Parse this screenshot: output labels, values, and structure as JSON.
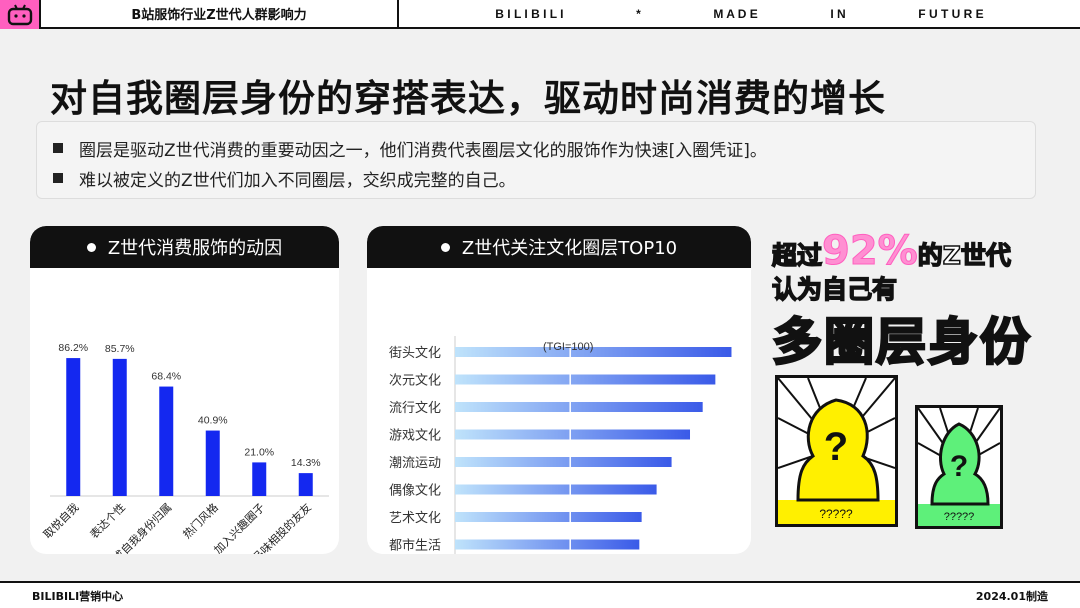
{
  "header": {
    "title": "B站服饰行业Z世代人群影响力",
    "slogan": [
      "B I L I B I L I",
      "*",
      "M A D E",
      "I N",
      "F U T U R E"
    ]
  },
  "headline": "对自我圈层身份的穿搭表达，驱动时尚消费的增长",
  "bullets": [
    "圈层是驱动Z世代消费的重要动因之一，他们消费代表圈层文化的服饰作为快速[入圈凭证]。",
    "难以被定义的Z世代们加入不同圈层，交织成完整的自己。"
  ],
  "chart_data": [
    {
      "type": "bar",
      "title": "Z世代消费服饰的动因",
      "categories": [
        "取悦自我",
        "表达个性",
        "形成自我身份归属",
        "热门风格",
        "加入兴趣圈子",
        "找到品味相投的友友"
      ],
      "values": [
        86.2,
        85.7,
        68.4,
        40.9,
        21.0,
        14.3
      ],
      "value_labels": [
        "86.2%",
        "85.7%",
        "68.4%",
        "40.9%",
        "21.0%",
        "14.3%"
      ],
      "ylim": [
        0,
        100
      ],
      "colors": {
        "bar": "#1428f0"
      }
    },
    {
      "type": "bar",
      "orientation": "horizontal",
      "title": "Z世代关注文化圈层TOP10",
      "categories": [
        "街头文化",
        "次元文化",
        "流行文化",
        "游戏文化",
        "潮流运动",
        "偶像文化",
        "艺术文化",
        "都市生活"
      ],
      "values": [
        240,
        226,
        215,
        204,
        188,
        175,
        162,
        160
      ],
      "reference_value": 100,
      "reference_label": "(TGI=100)",
      "xlim": [
        0,
        250
      ],
      "colors": {
        "bar_start": "#bfe3fb",
        "bar_end": "#3a5ae8"
      }
    }
  ],
  "callout": {
    "line1_pre": "超过",
    "line1_pct": "92%",
    "line1_post": "的Z世代",
    "line2": "认为自己有",
    "line3": "多圈层身份"
  },
  "posters": [
    {
      "caption": "?????",
      "glyph": "?",
      "color": "#fff000"
    },
    {
      "caption": "?????",
      "glyph": "?",
      "color": "#5ef07a"
    }
  ],
  "footer": {
    "left": "BILIBILI营销中心",
    "right": "2024.01制造"
  }
}
